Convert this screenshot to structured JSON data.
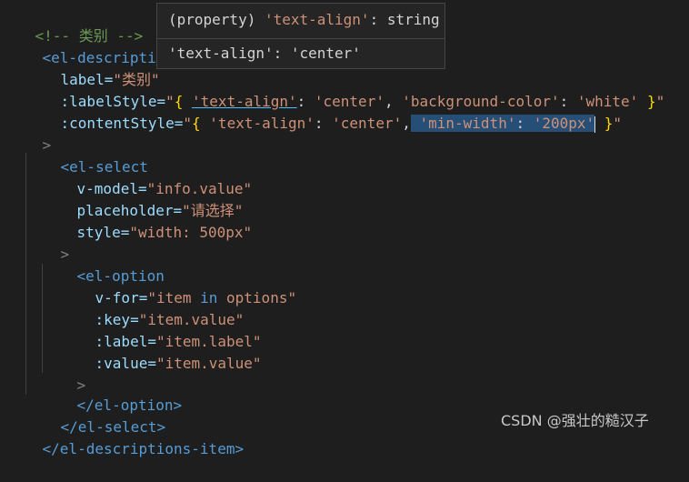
{
  "code": {
    "l0": "<!-- 类别 -->",
    "l1_tag": "<el-descriptions-",
    "l2_attr": "label=",
    "l2_val": "\"类别\"",
    "l3_attr": ":labelStyle=",
    "l3_q1": "\"",
    "l3_open": "{ ",
    "l3_key1": "'text-align'",
    "l3_colon1": ": ",
    "l3_val1": "'center'",
    "l3_comma1": ", ",
    "l3_key2": "'background-color'",
    "l3_colon2": ": ",
    "l3_val2": "'white'",
    "l3_close": " }",
    "l3_q2": "\"",
    "l4_attr": ":contentStyle=",
    "l4_q1": "\"",
    "l4_open": "{ ",
    "l4_key1": "'text-align'",
    "l4_colon1": ": ",
    "l4_val1": "'center'",
    "l4_comma1": ",",
    "l4_sel_key": " 'min-width'",
    "l4_sel_colon": ": ",
    "l4_sel_val": "'200px'",
    "l4_close": " }",
    "l4_q2": "\"",
    "l5": ">",
    "l6_tag": "<el-select",
    "l7_attr": "v-model=",
    "l7_val": "\"info.value\"",
    "l8_attr": "placeholder=",
    "l8_val": "\"请选择\"",
    "l9_attr": "style=",
    "l9_val": "\"width: 500px\"",
    "l10": ">",
    "l11_tag": "<el-option",
    "l12_attr": "v-for=",
    "l12_val_a": "\"item ",
    "l12_kw": "in",
    "l12_val_b": " options\"",
    "l13_attr": ":key=",
    "l13_val": "\"item.value\"",
    "l14_attr": ":label=",
    "l14_val": "\"item.label\"",
    "l15_attr": ":value=",
    "l15_val": "\"item.value\"",
    "l16": ">",
    "l17_tag": "</el-option>",
    "l18_tag": "</el-select>",
    "l19_tag": "</el-descriptions-item>"
  },
  "tooltip": {
    "signature_prefix": "(property) ",
    "signature_name": "'text-align'",
    "signature_type": ": string",
    "doc": "'text-align': 'center'"
  },
  "watermark": "CSDN @强壮的糙汉子"
}
